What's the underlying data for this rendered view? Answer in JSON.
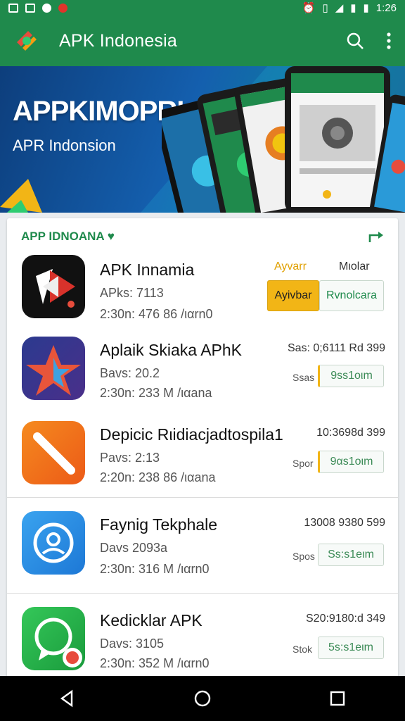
{
  "status_bar": {
    "time": "1:26"
  },
  "appbar": {
    "title": "APK Indonesia"
  },
  "banner": {
    "title": "APPKIMOPRI",
    "subtitle": "APR Indonsion"
  },
  "section": {
    "header": "APP IDNOANA ♥"
  },
  "apps": [
    {
      "name": "APK Innamia",
      "meta1": "APks: 7113",
      "meta2": "2:30n: 476 86 /ιαrn0",
      "right_top_a": "Ayvarr",
      "right_top_b": "Mιolar",
      "btn_primary": "Ayivbar",
      "btn_secondary": "Rvnolcara"
    },
    {
      "name": "Aplaik Skiaka APhK",
      "meta1": "Bavs: 20.2",
      "meta2": "2:30n: 233 M /ιαana",
      "right_top": "Sas: 0;6111 Rd 399",
      "right_small": "Ssas",
      "button": "9ss1oιm"
    },
    {
      "name": "Depicic Rιidiacjadtospila1",
      "meta1": "Pavs: 2:13",
      "meta2": "2:20n: 238 86 /ιαana",
      "right_top": "10:3698d 399",
      "right_small": "Spor",
      "button": "9αs1oιm"
    },
    {
      "name": "Faynig Tekphale",
      "meta1": "Davs 2093a",
      "meta2": "2:30n: 316 M /ιαrn0",
      "right_top": "13008 9380 599",
      "right_small": "Spos",
      "button": "Ss:s1eιm"
    },
    {
      "name": "Kedicklar APK",
      "meta1": "Davs: 3105",
      "meta2": "2:30n: 352 M /ιαrn0",
      "right_top": "S20:9180:d 349",
      "right_small": "Stok",
      "button": "5s:s1eιm"
    }
  ],
  "colors": {
    "primary": "#1f8a4c",
    "accent": "#f2b516"
  }
}
